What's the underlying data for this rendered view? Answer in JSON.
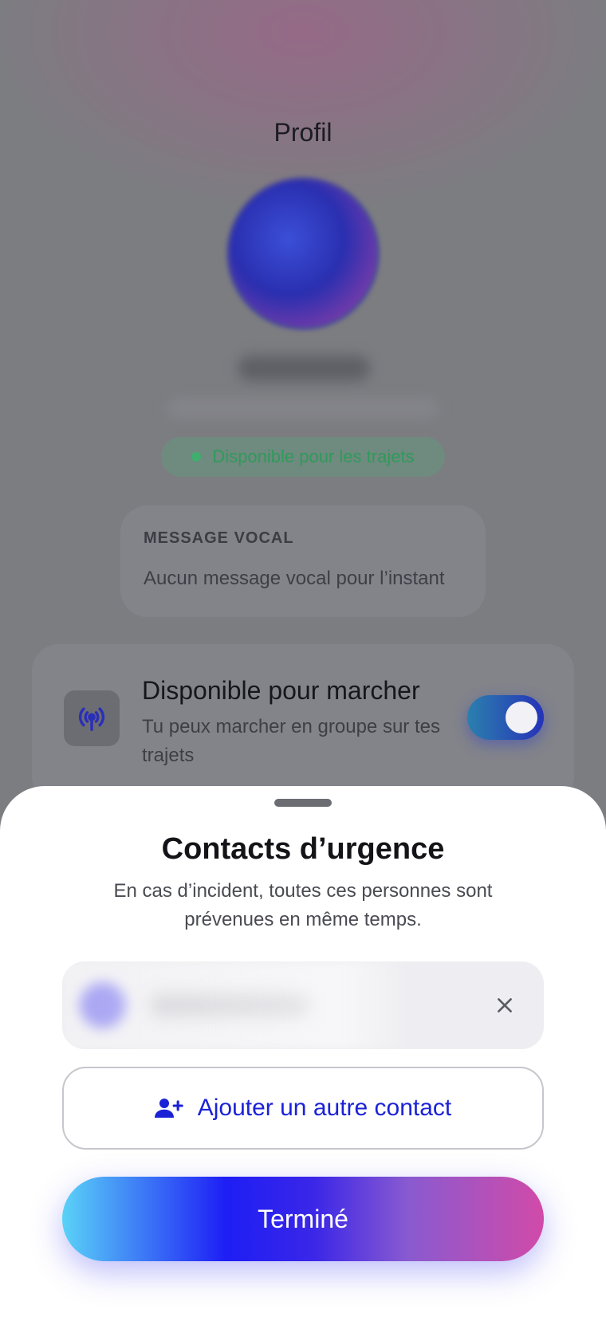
{
  "profile": {
    "title": "Profil",
    "status": "Disponible pour les trajets",
    "voice_message": {
      "label": "MESSAGE VOCAL",
      "text": "Aucun message vocal pour l’instant"
    },
    "walk": {
      "title": "Disponible pour marcher",
      "subtitle": "Tu peux marcher en groupe sur tes trajets",
      "toggle_on": true,
      "icon": "broadcast-icon"
    }
  },
  "sheet": {
    "title": "Contacts d’urgence",
    "description": "En cas d’incident, toutes ces personnes sont prévenues en même temps.",
    "add_contact_label": "Ajouter un autre contact",
    "done_label": "Terminé"
  },
  "colors": {
    "accent_blue": "#1b22d6",
    "status_green": "#2f9a5c",
    "gradient_start": "#5ad2f7",
    "gradient_end": "#d14aa8"
  }
}
